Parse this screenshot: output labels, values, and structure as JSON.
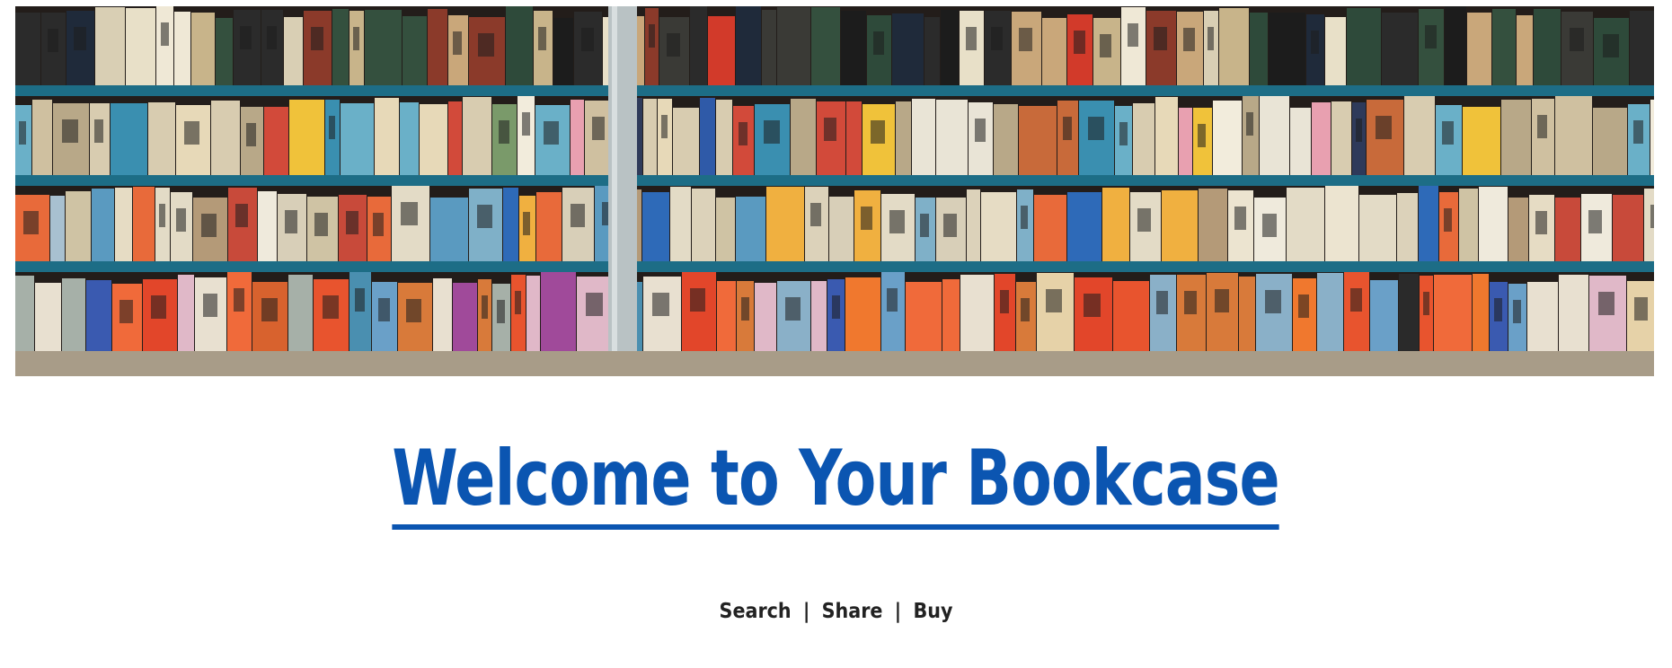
{
  "hero": {
    "image_name": "bookshelf-banner",
    "shelf_color": "#1d6d86",
    "frame_color": "#b9c2c4",
    "floor_color": "#a89c88"
  },
  "title": {
    "text": "Welcome to Your Bookcase",
    "color": "#0b55b1"
  },
  "tagline": {
    "search": "Search",
    "share": "Share",
    "buy": "Buy",
    "separator": "|",
    "color": "#222222"
  }
}
